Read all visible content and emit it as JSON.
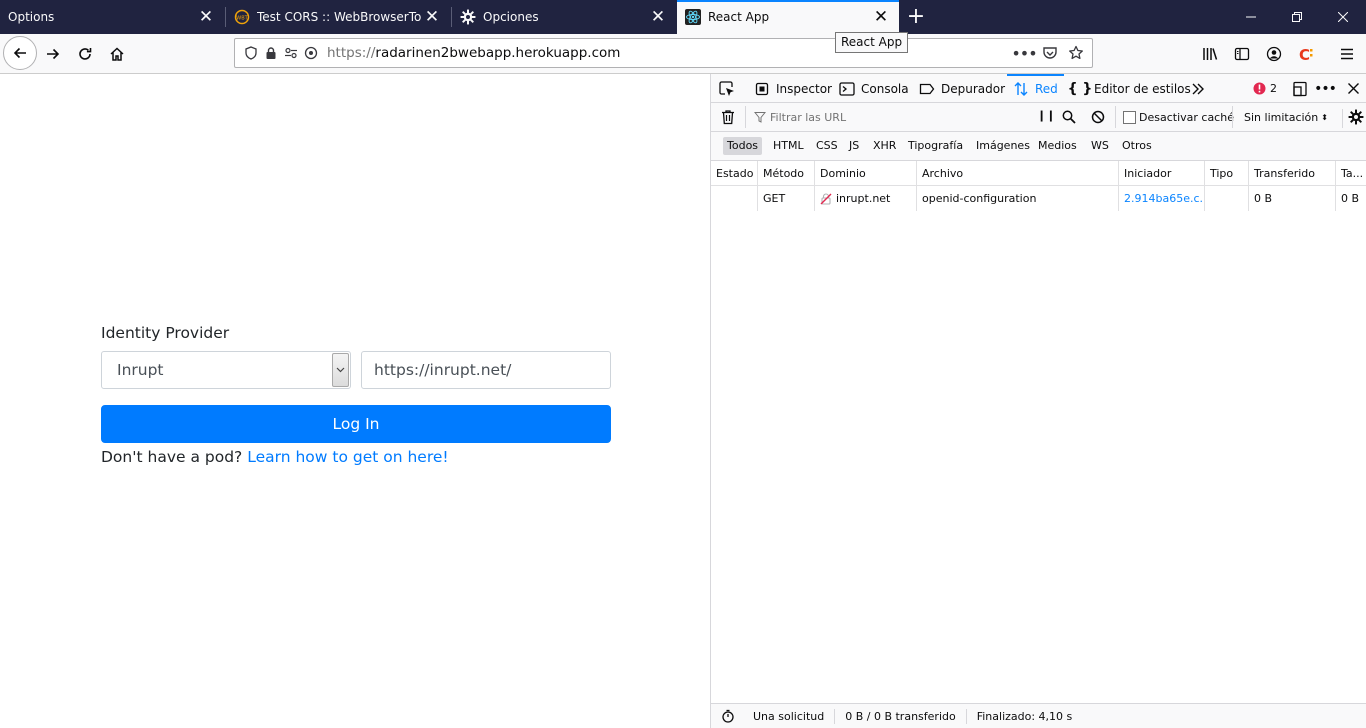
{
  "tabs": [
    {
      "label": "Options",
      "icon": "none"
    },
    {
      "label": "Test CORS :: WebBrowserTools",
      "icon": "webbrowsertools-icon"
    },
    {
      "label": "Opciones",
      "icon": "gear-icon"
    },
    {
      "label": "React App",
      "icon": "react-icon",
      "selected": true
    }
  ],
  "tooltip": "React App",
  "urlbar": {
    "scheme": "https://",
    "host": "radarinen2bwebapp.herokuapp.com"
  },
  "page": {
    "idp_label": "Identity Provider",
    "idp_selected": "Inrupt",
    "idp_url_value": "https://inrupt.net/",
    "login_label": "Log In",
    "nopod_text": "Don't have a pod?",
    "nopod_link": "Learn how to get on here!"
  },
  "devtools": {
    "tabs": {
      "inspector": "Inspector",
      "console": "Consola",
      "debugger": "Depurador",
      "network": "Red",
      "style_editor": "Editor de estilos"
    },
    "error_count": "2",
    "filter_placeholder": "Filtrar las URL",
    "disable_cache_label": "Desactivar caché",
    "throttling_label": "Sin limitación",
    "filter_types": [
      "Todos",
      "HTML",
      "CSS",
      "JS",
      "XHR",
      "Tipografía",
      "Imágenes",
      "Medios",
      "WS",
      "Otros"
    ],
    "columns": [
      "Estado",
      "Método",
      "Dominio",
      "Archivo",
      "Iniciador",
      "Tipo",
      "Transferido",
      "Ta..."
    ],
    "request": {
      "status": "",
      "method": "GET",
      "domain": "inrupt.net",
      "file": "openid-configuration",
      "initiator": "2.914ba65e.c...",
      "type": "",
      "transferred": "0 B",
      "size": "0 B"
    },
    "status_bar": {
      "requests": "Una solicitud",
      "transferred": "0 B / 0 B transferido",
      "finished": "Finalizado: 4,10 s"
    }
  },
  "colors": {
    "accent": "#0a84ff",
    "login_button": "#007bff",
    "tabstrip": "#202340"
  }
}
